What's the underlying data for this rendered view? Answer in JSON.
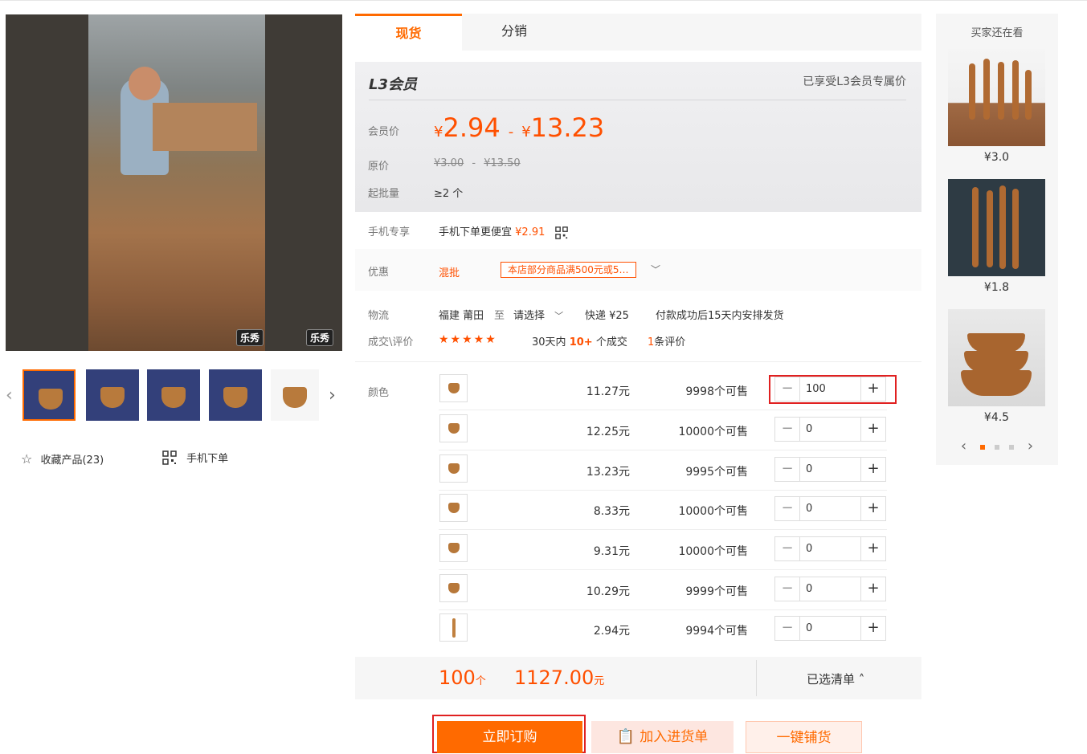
{
  "tabs": [
    "现货",
    "分销"
  ],
  "member": {
    "level": "L3会员",
    "note": "已享受L3会员专属价",
    "price_label": "会员价",
    "price_low": "2.94",
    "price_high": "13.23",
    "currency": "¥",
    "orig_label": "原价",
    "orig_low": "¥3.00",
    "orig_high": "¥13.50",
    "moq_label": "起批量",
    "moq": "≥2 个"
  },
  "mobile": {
    "label": "手机专享",
    "text": "手机下单更便宜",
    "price": "¥2.91"
  },
  "promo": {
    "label": "优惠",
    "mix": "混批",
    "coupon": "本店部分商品满500元或5…"
  },
  "logistics": {
    "label": "物流",
    "from": "福建 莆田",
    "to": "至",
    "select": "请选择",
    "express": "快递 ¥25",
    "ship": "付款成功后15天内安排发货"
  },
  "deal": {
    "label": "成交\\评价",
    "stars": "★★★★★",
    "prefix": "30天内",
    "count": "10+",
    "suffix": "个成交",
    "reviews_num": "1",
    "reviews_text": "条评价"
  },
  "sku": {
    "label": "颜色",
    "rows": [
      {
        "price": "11.27元",
        "stock": "9998个可售",
        "qty": "100"
      },
      {
        "price": "12.25元",
        "stock": "10000个可售",
        "qty": "0"
      },
      {
        "price": "13.23元",
        "stock": "9995个可售",
        "qty": "0"
      },
      {
        "price": "8.33元",
        "stock": "10000个可售",
        "qty": "0"
      },
      {
        "price": "9.31元",
        "stock": "10000个可售",
        "qty": "0"
      },
      {
        "price": "10.29元",
        "stock": "9999个可售",
        "qty": "0"
      },
      {
        "price": "2.94元",
        "stock": "9994个可售",
        "qty": "0"
      }
    ]
  },
  "summary": {
    "qty": "100",
    "qty_unit": "个",
    "amount": "1127.00",
    "amount_unit": "元",
    "list": "已选清单 ˄"
  },
  "buttons": {
    "buy": "立即订购",
    "cart": "加入进货单",
    "dist": "一键铺货"
  },
  "gallery": {
    "logo1": "乐秀",
    "logo2": "乐秀",
    "collect": "收藏产品(23)",
    "mobile_order": "手机下单"
  },
  "reco": {
    "title": "买家还在看",
    "items": [
      {
        "price": "¥3.0"
      },
      {
        "price": "¥1.8"
      },
      {
        "price": "¥4.5"
      }
    ]
  },
  "colors": {
    "accent": "#ff6a00",
    "price": "#ff5000",
    "highlight": "#e02020"
  }
}
